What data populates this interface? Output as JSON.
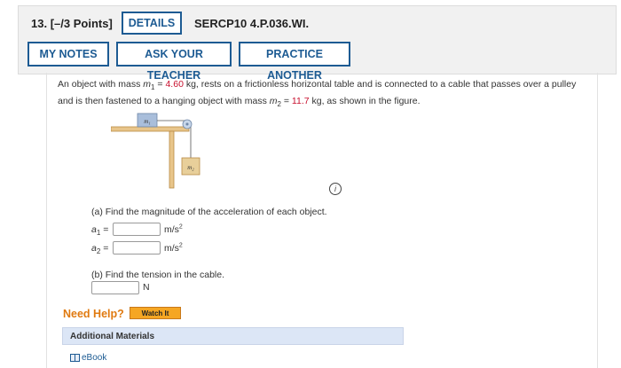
{
  "header": {
    "question_number": "13.",
    "points": "[–/3 Points]",
    "details_label": "DETAILS",
    "problem_code": "SERCP10 4.P.036.WI.",
    "my_notes_label": "MY NOTES",
    "ask_teacher_label": "ASK YOUR TEACHER",
    "practice_another_label": "PRACTICE ANOTHER"
  },
  "problem": {
    "text1": "An object with mass ",
    "m1_symbol": "m",
    "m1_sub": "1",
    "eq1": " = ",
    "m1_value": "4.60",
    "text2": " kg, rests on a frictionless horizontal table and is connected to a cable that passes over a pulley and is then fastened to a hanging object with mass ",
    "m2_symbol": "m",
    "m2_sub": "2",
    "eq2": " = ",
    "m2_value": "11.7",
    "text3": " kg, as shown in the figure.",
    "figure_label_m1": "m₁",
    "figure_label_m2": "m₂",
    "info_icon_glyph": "i",
    "value_color": "#c8102e"
  },
  "part_a": {
    "prompt": "(a) Find the magnitude of the acceleration of each object.",
    "a1_symbol": "a",
    "a1_sub": "1",
    "a2_symbol": "a",
    "a2_sub": "2",
    "equals": "=",
    "unit": "m/s",
    "unit_exp": "2",
    "a1_value": "",
    "a2_value": ""
  },
  "part_b": {
    "prompt": "(b) Find the tension in the cable.",
    "unit": "N",
    "value": ""
  },
  "help": {
    "need_help": "Need Help?",
    "watch_it": "Watch It",
    "additional_materials": "Additional Materials",
    "ebook": "eBook"
  },
  "colors": {
    "button_border": "#1d5b93",
    "need_help": "#e07a10",
    "watch_it_bg": "#f5a623",
    "materials_bg": "#dce6f6"
  }
}
